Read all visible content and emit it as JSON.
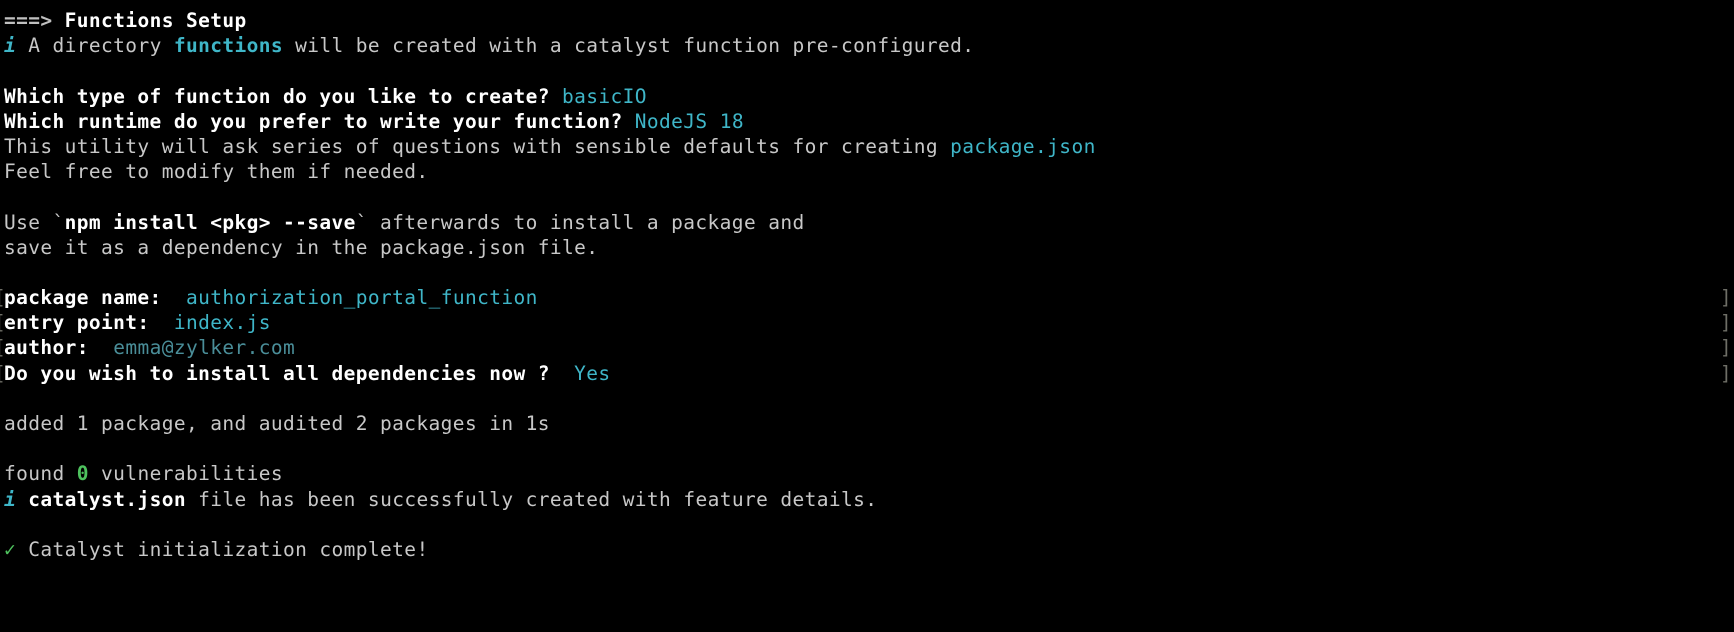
{
  "terminal": {
    "background_color": "#000000",
    "foreground_color": "#e6e6e6",
    "accent_cyan": "#3fb6c8",
    "accent_green": "#4ec25e",
    "frame_color": "#6e6e66"
  },
  "header": {
    "arrow": "===>",
    "title": "Functions Setup"
  },
  "info_directory": {
    "icon": "i",
    "text_before": " A directory ",
    "highlight": "functions",
    "text_after": " will be created with a catalyst function pre-configured."
  },
  "questions": [
    {
      "label": "Which type of function do you like to create?",
      "answer": "basicIO"
    },
    {
      "label": "Which runtime do you prefer to write your function?",
      "answer": "NodeJS 18"
    }
  ],
  "utility_notice": {
    "line1_before": "This utility will ask series of questions with sensible defaults for creating ",
    "line1_highlight": "package.json",
    "line2": "Feel free to modify them if needed."
  },
  "npm_hint": {
    "line1_before": "Use `",
    "line1_bold": "npm install <pkg> --save",
    "line1_after": "` afterwards to install a package and",
    "line2": "save it as a dependency in the package.json file."
  },
  "prompts": [
    {
      "label": "package name:",
      "value": "authorization_portal_function",
      "value_style": "cyan",
      "bracket_left": "[",
      "bracket_right": "]"
    },
    {
      "label": "entry point:",
      "value": "index.js",
      "value_style": "cyan",
      "bracket_left": "[",
      "bracket_right": "]"
    },
    {
      "label": "author:",
      "value": "emma@zylker.com",
      "value_style": "cyan-dim",
      "bracket_left": "[",
      "bracket_right": "]"
    },
    {
      "label": "Do you wish to install all dependencies now ?",
      "value": "Yes",
      "value_style": "cyan",
      "bracket_left": "[",
      "bracket_right": "]"
    }
  ],
  "npm_output": {
    "added_line": "added 1 package, and audited 2 packages in 1s",
    "found_before": "found ",
    "found_count": "0",
    "found_after": " vulnerabilities"
  },
  "info_catalyst": {
    "icon": "i",
    "file": "catalyst.json",
    "text_after": " file has been successfully created with feature details."
  },
  "success": {
    "icon": "✓",
    "text": "Catalyst initialization complete!"
  }
}
